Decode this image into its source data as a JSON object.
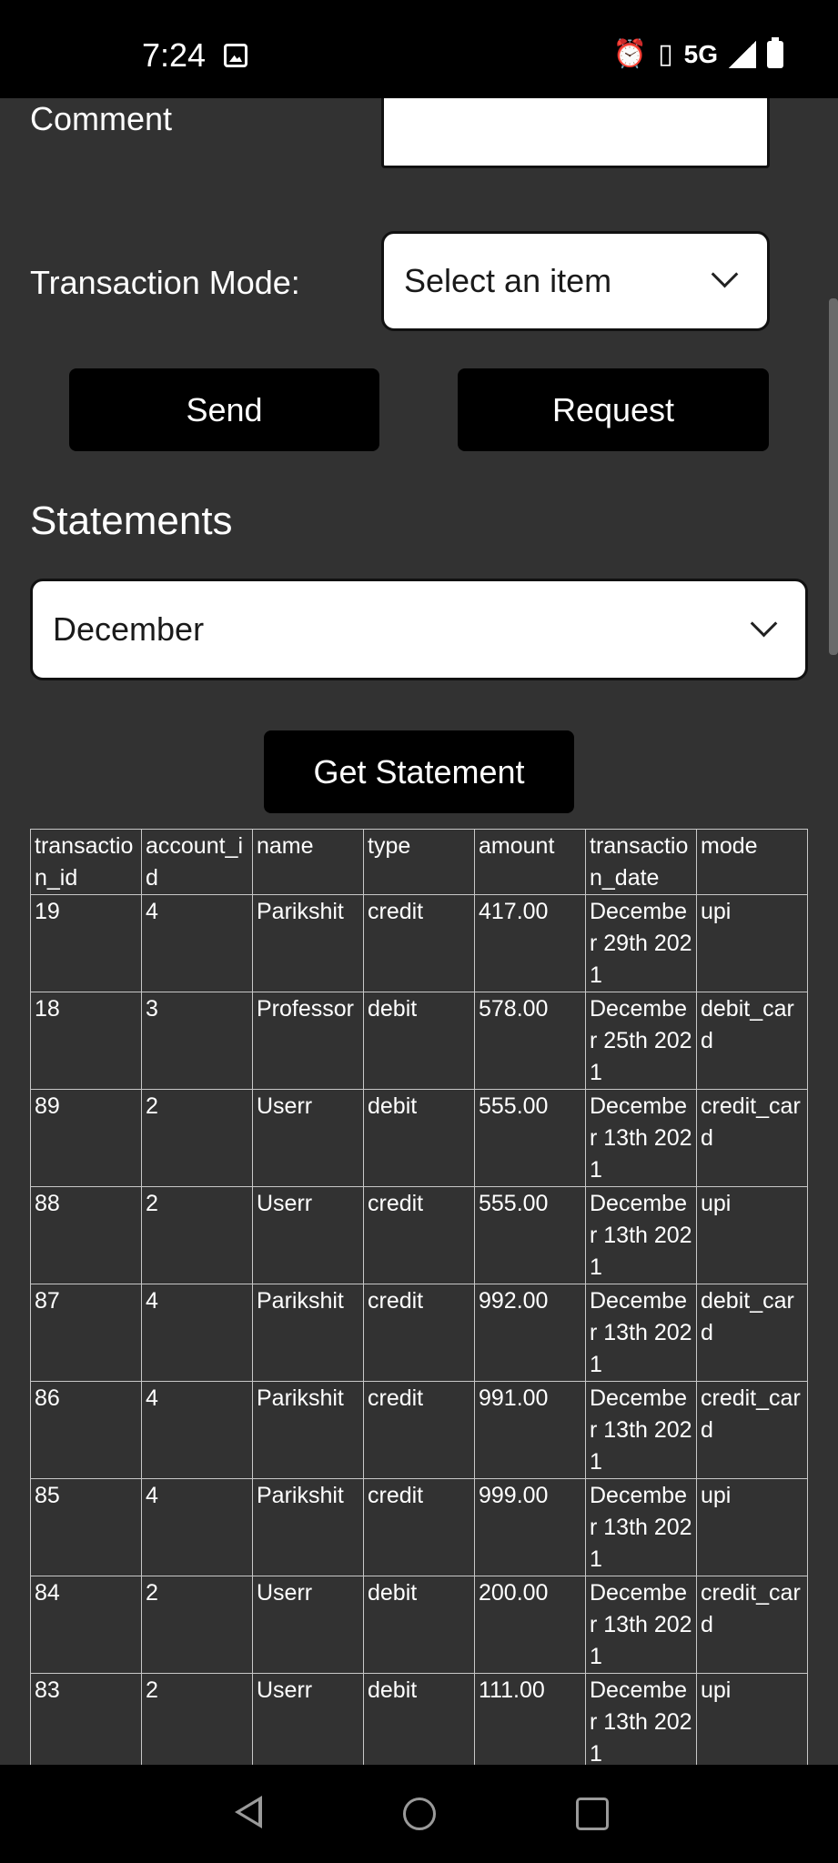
{
  "status_bar": {
    "time": "7:24",
    "network": "5G",
    "icons": [
      "image-icon",
      "alarm-icon",
      "vibrate-icon",
      "signal-icon",
      "battery-icon"
    ]
  },
  "form": {
    "comment_label": "Comment",
    "comment_value": "",
    "mode_label": "Transaction Mode:",
    "mode_select_value": "Select an item",
    "send_label": "Send",
    "request_label": "Request"
  },
  "statements": {
    "heading": "Statements",
    "month_value": "December",
    "get_statement_label": "Get Statement"
  },
  "table": {
    "headers": [
      "transaction_id",
      "account_id",
      "name",
      "type",
      "amount",
      "transaction_date",
      "mode"
    ],
    "rows": [
      [
        "19",
        "4",
        "Parikshit",
        "credit",
        "417.00",
        "December 29th 2021",
        "upi"
      ],
      [
        "18",
        "3",
        "Professor",
        "debit",
        "578.00",
        "December 25th 2021",
        "debit_card"
      ],
      [
        "89",
        "2",
        "Userr",
        "debit",
        "555.00",
        "December 13th 2021",
        "credit_card"
      ],
      [
        "88",
        "2",
        "Userr",
        "credit",
        "555.00",
        "December 13th 2021",
        "upi"
      ],
      [
        "87",
        "4",
        "Parikshit",
        "credit",
        "992.00",
        "December 13th 2021",
        "debit_card"
      ],
      [
        "86",
        "4",
        "Parikshit",
        "credit",
        "991.00",
        "December 13th 2021",
        "credit_card"
      ],
      [
        "85",
        "4",
        "Parikshit",
        "credit",
        "999.00",
        "December 13th 2021",
        "upi"
      ],
      [
        "84",
        "2",
        "Userr",
        "debit",
        "200.00",
        "December 13th 2021",
        "credit_card"
      ],
      [
        "83",
        "2",
        "Userr",
        "debit",
        "111.00",
        "December 13th 2021",
        "upi"
      ]
    ]
  },
  "colors": {
    "background": "#323232",
    "button": "#000000",
    "text": "#ffffff"
  }
}
